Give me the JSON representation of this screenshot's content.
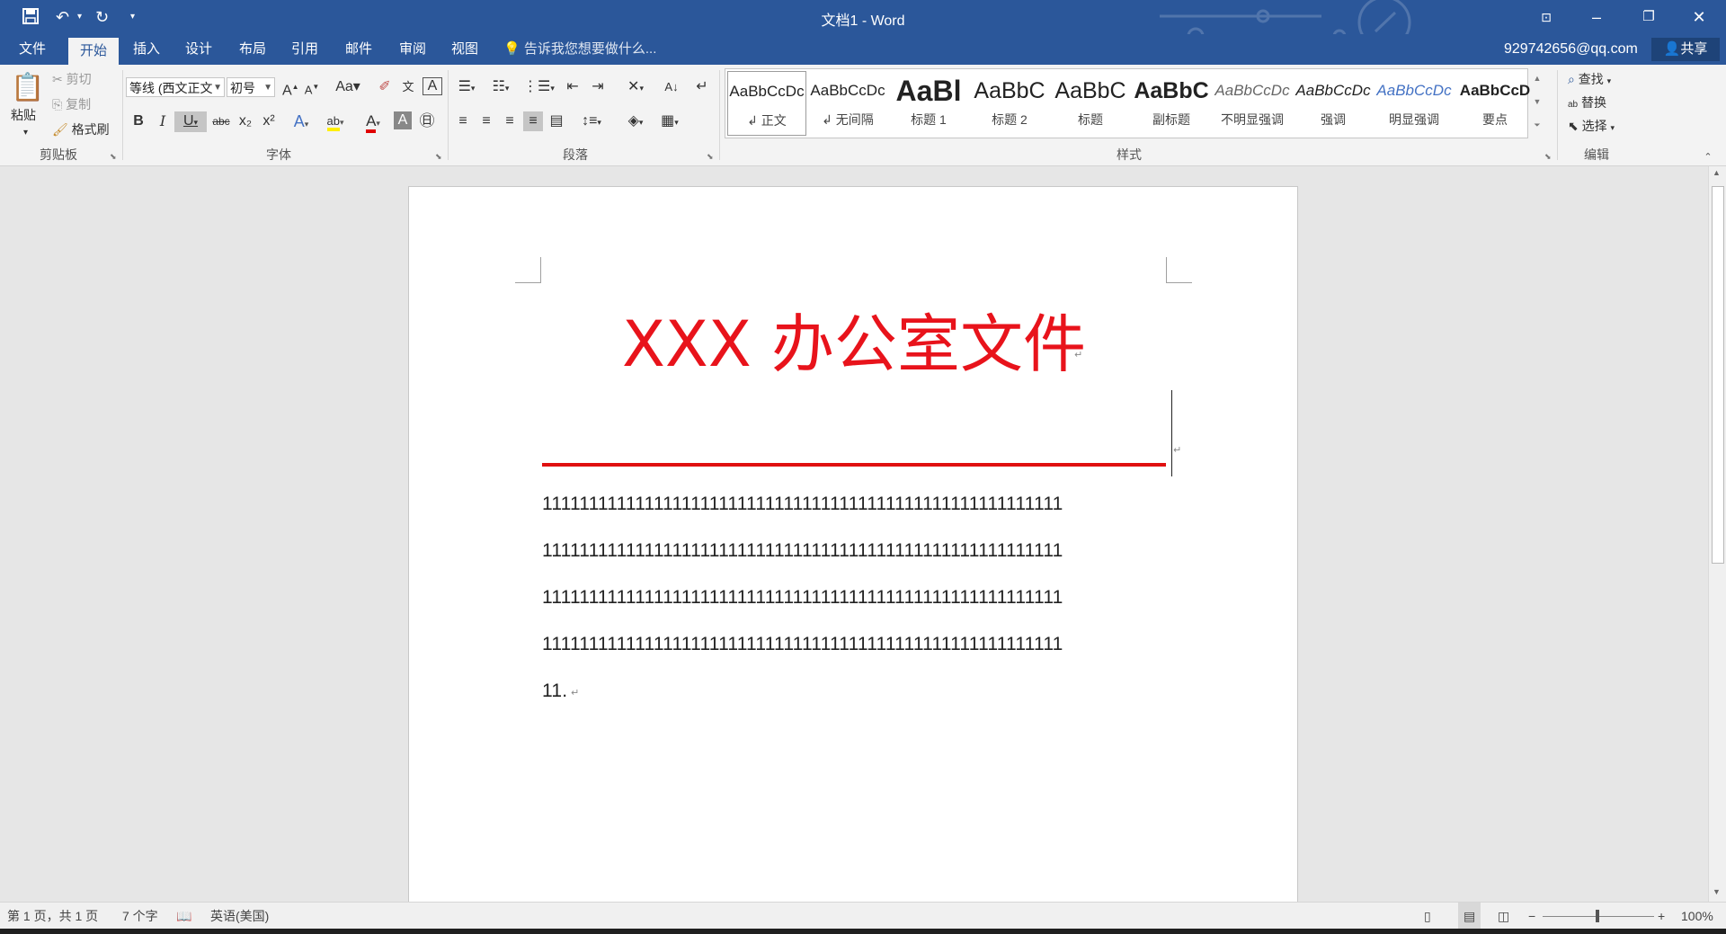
{
  "window": {
    "title": "文档1 - Word",
    "minimize_icon": "minimize-icon",
    "restore_icon": "restore-icon",
    "close_icon": "close-icon",
    "ribbon_display_icon": "ribbon-display-options-icon"
  },
  "quick_access": {
    "save_icon": "save-icon",
    "undo_icon": "undo-icon",
    "redo_icon": "repeat-icon",
    "customize_icon": "customize-qat-icon"
  },
  "tabs": [
    "文件",
    "开始",
    "插入",
    "设计",
    "布局",
    "引用",
    "邮件",
    "审阅",
    "视图"
  ],
  "active_tab": "开始",
  "tell_me": "告诉我您想要做什么...",
  "account": "929742656@qq.com",
  "share": "共享",
  "clipboard": {
    "paste": "粘贴",
    "cut": "剪切",
    "copy": "复制",
    "format_painter": "格式刷",
    "group": "剪贴板"
  },
  "font": {
    "font_name": "等线 (西文正文",
    "font_size": "初号",
    "group": "字体",
    "bold": "B",
    "italic": "I",
    "underline": "U",
    "strike": "abc",
    "subscript": "x₂",
    "superscript": "x²",
    "change_case": "Aa",
    "grow": "A",
    "shrink": "A"
  },
  "paragraph": {
    "group": "段落"
  },
  "styles": {
    "group": "样式",
    "items": [
      {
        "preview": "AaBbCcDc",
        "name": "↲ 正文"
      },
      {
        "preview": "AaBbCcDc",
        "name": "↲ 无间隔"
      },
      {
        "preview": "AaBl",
        "name": "标题 1"
      },
      {
        "preview": "AaBbC",
        "name": "标题 2"
      },
      {
        "preview": "AaBbC",
        "name": "标题"
      },
      {
        "preview": "AaBbC",
        "name": "副标题"
      },
      {
        "preview": "AaBbCcDc",
        "name": "不明显强调"
      },
      {
        "preview": "AaBbCcDc",
        "name": "强调"
      },
      {
        "preview": "AaBbCcDc",
        "name": "明显强调"
      },
      {
        "preview": "AaBbCcD",
        "name": "要点"
      }
    ]
  },
  "editing": {
    "group": "编辑",
    "find": "查找",
    "replace": "替换",
    "select": "选择"
  },
  "document": {
    "heading": "XXX 办公室文件",
    "heading_color": "#e8131b",
    "rule_color": "#e01010",
    "lines": [
      "11111111111111111111111111111111111111111111111111111111",
      "11111111111111111111111111111111111111111111111111111111",
      "11111111111111111111111111111111111111111111111111111111",
      "11111111111111111111111111111111111111111111111111111111",
      "11."
    ]
  },
  "status": {
    "page": "第 1 页，共 1 页",
    "words": "7 个字",
    "language": "英语(美国)",
    "zoom": "100%",
    "zoom_minus": "−",
    "zoom_plus": "+"
  },
  "colors": {
    "brand": "#2b579a",
    "ribbon": "#f3f3f3"
  }
}
